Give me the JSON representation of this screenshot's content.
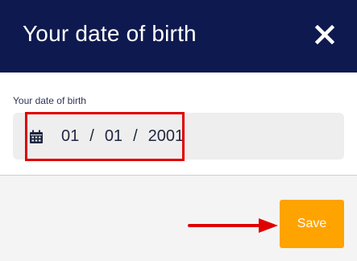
{
  "header": {
    "title": "Your date of birth",
    "close_icon": "close-icon"
  },
  "form": {
    "label": "Your date of birth",
    "date": {
      "month": "01",
      "day": "01",
      "year": "2001",
      "separator": "/"
    },
    "calendar_icon": "calendar-icon"
  },
  "footer": {
    "save_label": "Save"
  },
  "colors": {
    "header_bg": "#0e1a4f",
    "save_bg": "#ffa300",
    "annotation": "#e00000"
  }
}
